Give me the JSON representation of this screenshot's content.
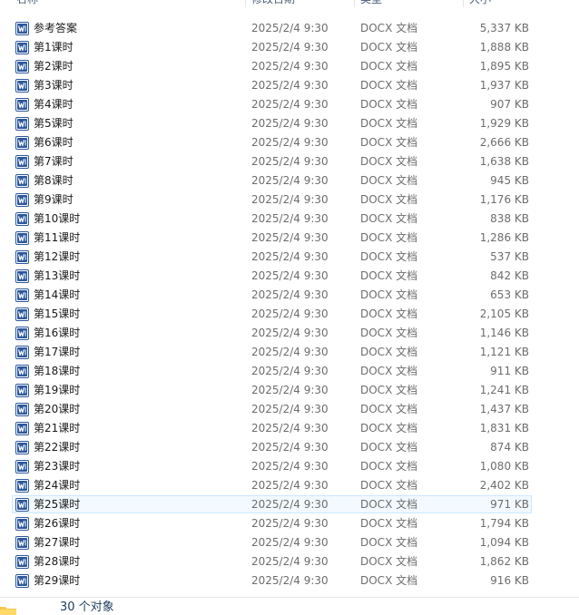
{
  "columns": {
    "name": "名称",
    "date": "修改日期",
    "type": "类型",
    "size": "大小"
  },
  "files": [
    {
      "name": "参考答案",
      "date": "2025/2/4 9:30",
      "type": "DOCX 文档",
      "size": "5,337 KB"
    },
    {
      "name": "第1课时",
      "date": "2025/2/4 9:30",
      "type": "DOCX 文档",
      "size": "1,888 KB"
    },
    {
      "name": "第2课时",
      "date": "2025/2/4 9:30",
      "type": "DOCX 文档",
      "size": "1,895 KB"
    },
    {
      "name": "第3课时",
      "date": "2025/2/4 9:30",
      "type": "DOCX 文档",
      "size": "1,937 KB"
    },
    {
      "name": "第4课时",
      "date": "2025/2/4 9:30",
      "type": "DOCX 文档",
      "size": "907 KB"
    },
    {
      "name": "第5课时",
      "date": "2025/2/4 9:30",
      "type": "DOCX 文档",
      "size": "1,929 KB"
    },
    {
      "name": "第6课时",
      "date": "2025/2/4 9:30",
      "type": "DOCX 文档",
      "size": "2,666 KB"
    },
    {
      "name": "第7课时",
      "date": "2025/2/4 9:30",
      "type": "DOCX 文档",
      "size": "1,638 KB"
    },
    {
      "name": "第8课时",
      "date": "2025/2/4 9:30",
      "type": "DOCX 文档",
      "size": "945 KB"
    },
    {
      "name": "第9课时",
      "date": "2025/2/4 9:30",
      "type": "DOCX 文档",
      "size": "1,176 KB"
    },
    {
      "name": "第10课时",
      "date": "2025/2/4 9:30",
      "type": "DOCX 文档",
      "size": "838 KB"
    },
    {
      "name": "第11课时",
      "date": "2025/2/4 9:30",
      "type": "DOCX 文档",
      "size": "1,286 KB"
    },
    {
      "name": "第12课时",
      "date": "2025/2/4 9:30",
      "type": "DOCX 文档",
      "size": "537 KB"
    },
    {
      "name": "第13课时",
      "date": "2025/2/4 9:30",
      "type": "DOCX 文档",
      "size": "842 KB"
    },
    {
      "name": "第14课时",
      "date": "2025/2/4 9:30",
      "type": "DOCX 文档",
      "size": "653 KB"
    },
    {
      "name": "第15课时",
      "date": "2025/2/4 9:30",
      "type": "DOCX 文档",
      "size": "2,105 KB"
    },
    {
      "name": "第16课时",
      "date": "2025/2/4 9:30",
      "type": "DOCX 文档",
      "size": "1,146 KB"
    },
    {
      "name": "第17课时",
      "date": "2025/2/4 9:30",
      "type": "DOCX 文档",
      "size": "1,121 KB"
    },
    {
      "name": "第18课时",
      "date": "2025/2/4 9:30",
      "type": "DOCX 文档",
      "size": "911 KB"
    },
    {
      "name": "第19课时",
      "date": "2025/2/4 9:30",
      "type": "DOCX 文档",
      "size": "1,241 KB"
    },
    {
      "name": "第20课时",
      "date": "2025/2/4 9:30",
      "type": "DOCX 文档",
      "size": "1,437 KB"
    },
    {
      "name": "第21课时",
      "date": "2025/2/4 9:30",
      "type": "DOCX 文档",
      "size": "1,831 KB"
    },
    {
      "name": "第22课时",
      "date": "2025/2/4 9:30",
      "type": "DOCX 文档",
      "size": "874 KB"
    },
    {
      "name": "第23课时",
      "date": "2025/2/4 9:30",
      "type": "DOCX 文档",
      "size": "1,080 KB"
    },
    {
      "name": "第24课时",
      "date": "2025/2/4 9:30",
      "type": "DOCX 文档",
      "size": "2,402 KB"
    },
    {
      "name": "第25课时",
      "date": "2025/2/4 9:30",
      "type": "DOCX 文档",
      "size": "971 KB",
      "selected": true
    },
    {
      "name": "第26课时",
      "date": "2025/2/4 9:30",
      "type": "DOCX 文档",
      "size": "1,794 KB"
    },
    {
      "name": "第27课时",
      "date": "2025/2/4 9:30",
      "type": "DOCX 文档",
      "size": "1,094 KB"
    },
    {
      "name": "第28课时",
      "date": "2025/2/4 9:30",
      "type": "DOCX 文档",
      "size": "1,862 KB"
    },
    {
      "name": "第29课时",
      "date": "2025/2/4 9:30",
      "type": "DOCX 文档",
      "size": "916 KB"
    }
  ],
  "status_bar": {
    "item_count": "30 个对象"
  },
  "icons": {
    "file": "word-doc-icon",
    "status": "folder-icon"
  },
  "colors": {
    "word_blue": "#2b579a",
    "selection_border": "#cde8ff",
    "selection_fill": "#f2f9ff"
  }
}
